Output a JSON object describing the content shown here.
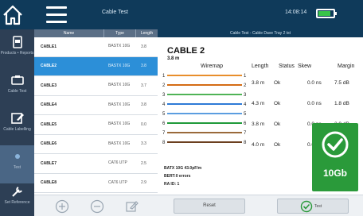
{
  "header": {
    "title": "Cable Test",
    "time": "14:08:14",
    "battery_level": 0.85,
    "battery_color": "#39c44a"
  },
  "sidebar": {
    "items": [
      {
        "icon": "product-report-icon",
        "label": "Products • Reports"
      },
      {
        "icon": "cable-icon",
        "label": "Cable Test"
      },
      {
        "icon": "edit-icon",
        "label": "Cable Labelling"
      },
      {
        "icon": "active-icon",
        "label": "Test"
      },
      {
        "icon": "wrench-icon",
        "label": "Set Reference"
      }
    ]
  },
  "cable_list": {
    "headers": {
      "name": "Name",
      "type": "Type",
      "length": "Length"
    },
    "rows": [
      {
        "name": "CABLE1",
        "type": "BASTX 10G",
        "length": "3.8"
      },
      {
        "name": "CABLE2",
        "type": "BASTX 10G",
        "length": "3.8",
        "selected": true
      },
      {
        "name": "CABLE3",
        "type": "BASTX 10G",
        "length": "3.7"
      },
      {
        "name": "CABLE4",
        "type": "BASTX 10G",
        "length": "3.8"
      },
      {
        "name": "CABLE5",
        "type": "BASTX 10G",
        "length": "0.0"
      },
      {
        "name": "CABLE6",
        "type": "BASTX 10G",
        "length": "3.3"
      },
      {
        "name": "CABLE7",
        "type": "CAT6 UTP",
        "length": "2.5"
      },
      {
        "name": "CABLE8",
        "type": "CAT6 UTP",
        "length": "2.9"
      },
      {
        "name": "CABLE9",
        "type": "CAT6 UTP",
        "length": "2.9"
      }
    ],
    "toolbar": [
      "add-icon",
      "remove-icon",
      "edit-icon"
    ]
  },
  "detail": {
    "header": "Cable Test - Cable Dave Tray 2 tst",
    "cable_name": "CABLE 2",
    "cable_length": "3.8 m",
    "wiremap_label": "Wiremap",
    "columns": [
      "Length",
      "Status",
      "Skew",
      "Margin"
    ],
    "pairs": [
      {
        "length": "3.8 m",
        "status": "Ok",
        "skew": "0.0 ns",
        "margin": "7.5 dB"
      },
      {
        "length": "4.3 m",
        "status": "Ok",
        "skew": "0.0 ns",
        "margin": "1.8 dB"
      },
      {
        "length": "3.8 m",
        "status": "Ok",
        "skew": "0.0 ns",
        "margin": "2.9 dB"
      },
      {
        "length": "4.0 m",
        "status": "Ok",
        "skew": "0.0 ns",
        "margin": "5.7 dB"
      }
    ],
    "wire_numbers": [
      "1",
      "2",
      "3",
      "4",
      "5",
      "6",
      "7",
      "8"
    ],
    "wire_colors": [
      "#e88e2c",
      "#d46b14",
      "#4fb356",
      "#2d7ad6",
      "#5b9de0",
      "#1f9a3a",
      "#9a6a3a",
      "#6b3f1f"
    ],
    "spec": "BATX 10G  43.0pF/m",
    "errors": "BERT:0 errors",
    "id": "RA ID: 1",
    "result_speed": "10Gb",
    "result_color": "#2a9a3a"
  },
  "footer": {
    "reset_label": "Reset",
    "test_label": "Test"
  }
}
